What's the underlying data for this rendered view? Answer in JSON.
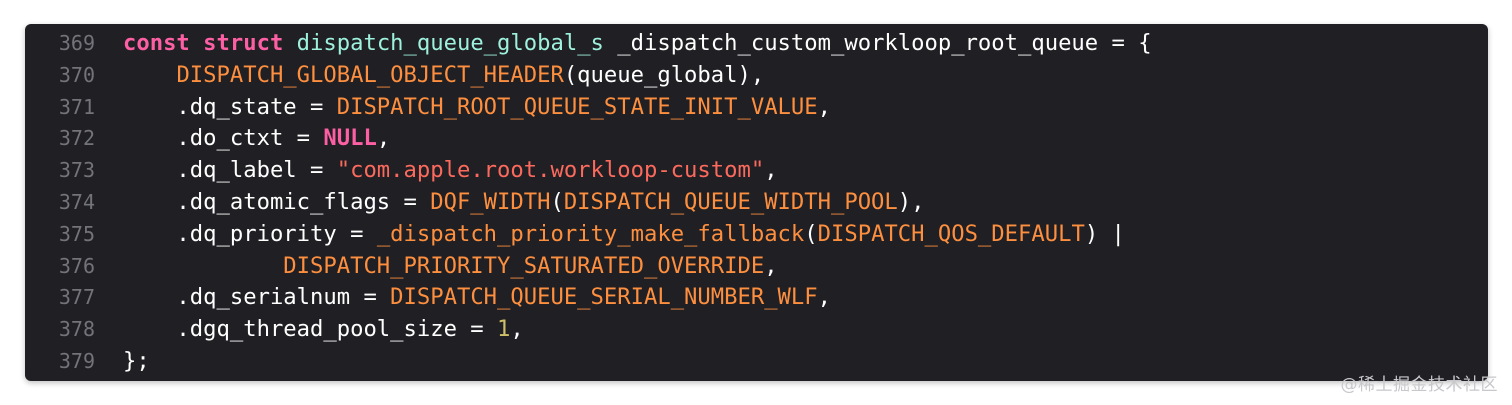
{
  "colors": {
    "background": "#1f1f24",
    "line_number": "#73747a",
    "keyword": "#fc5fa3",
    "type": "#9ef1dd",
    "plain": "#ffffff",
    "macro": "#fd8f3f",
    "string": "#fc6a5d",
    "number": "#d0bf69"
  },
  "lines": [
    {
      "n": "369",
      "tokens": [
        {
          "t": "const",
          "k": "keyword"
        },
        {
          "t": " ",
          "k": "plain"
        },
        {
          "t": "struct",
          "k": "keyword"
        },
        {
          "t": " ",
          "k": "plain"
        },
        {
          "t": "dispatch_queue_global_s",
          "k": "type"
        },
        {
          "t": " _dispatch_custom_workloop_root_queue = {",
          "k": "plain"
        }
      ]
    },
    {
      "n": "370",
      "tokens": [
        {
          "t": "    ",
          "k": "plain"
        },
        {
          "t": "DISPATCH_GLOBAL_OBJECT_HEADER",
          "k": "macro"
        },
        {
          "t": "(queue_global),",
          "k": "plain"
        }
      ]
    },
    {
      "n": "371",
      "tokens": [
        {
          "t": "    .dq_state = ",
          "k": "plain"
        },
        {
          "t": "DISPATCH_ROOT_QUEUE_STATE_INIT_VALUE",
          "k": "macro"
        },
        {
          "t": ",",
          "k": "plain"
        }
      ]
    },
    {
      "n": "372",
      "tokens": [
        {
          "t": "    .do_ctxt = ",
          "k": "plain"
        },
        {
          "t": "NULL",
          "k": "keyword"
        },
        {
          "t": ",",
          "k": "plain"
        }
      ]
    },
    {
      "n": "373",
      "tokens": [
        {
          "t": "    .dq_label = ",
          "k": "plain"
        },
        {
          "t": "\"com.apple.root.workloop-custom\"",
          "k": "string"
        },
        {
          "t": ",",
          "k": "plain"
        }
      ]
    },
    {
      "n": "374",
      "tokens": [
        {
          "t": "    .dq_atomic_flags = ",
          "k": "plain"
        },
        {
          "t": "DQF_WIDTH",
          "k": "macro"
        },
        {
          "t": "(",
          "k": "plain"
        },
        {
          "t": "DISPATCH_QUEUE_WIDTH_POOL",
          "k": "macro"
        },
        {
          "t": "),",
          "k": "plain"
        }
      ]
    },
    {
      "n": "375",
      "tokens": [
        {
          "t": "    .dq_priority = ",
          "k": "plain"
        },
        {
          "t": "_dispatch_priority_make_fallback",
          "k": "macro"
        },
        {
          "t": "(",
          "k": "plain"
        },
        {
          "t": "DISPATCH_QOS_DEFAULT",
          "k": "macro"
        },
        {
          "t": ") |",
          "k": "plain"
        }
      ]
    },
    {
      "n": "376",
      "tokens": [
        {
          "t": "            ",
          "k": "plain"
        },
        {
          "t": "DISPATCH_PRIORITY_SATURATED_OVERRIDE",
          "k": "macro"
        },
        {
          "t": ",",
          "k": "plain"
        }
      ]
    },
    {
      "n": "377",
      "tokens": [
        {
          "t": "    .dq_serialnum = ",
          "k": "plain"
        },
        {
          "t": "DISPATCH_QUEUE_SERIAL_NUMBER_WLF",
          "k": "macro"
        },
        {
          "t": ",",
          "k": "plain"
        }
      ]
    },
    {
      "n": "378",
      "tokens": [
        {
          "t": "    .dgq_thread_pool_size = ",
          "k": "plain"
        },
        {
          "t": "1",
          "k": "number"
        },
        {
          "t": ",",
          "k": "plain"
        }
      ]
    },
    {
      "n": "379",
      "tokens": [
        {
          "t": "};",
          "k": "plain"
        }
      ]
    }
  ],
  "watermark": "@稀土掘金技术社区"
}
